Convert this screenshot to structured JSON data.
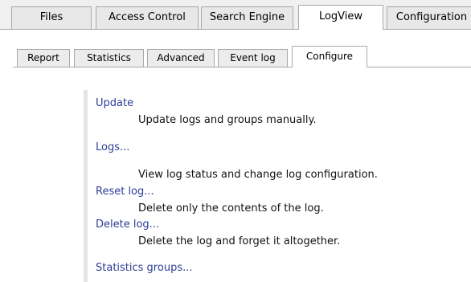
{
  "main_tabs": [
    {
      "label": "Files",
      "active": false
    },
    {
      "label": "Access Control",
      "active": false
    },
    {
      "label": "Search Engine",
      "active": false
    },
    {
      "label": "LogView",
      "active": true
    },
    {
      "label": "Configuration",
      "active": false
    }
  ],
  "sub_tabs": [
    {
      "label": "Report",
      "active": false
    },
    {
      "label": "Statistics",
      "active": false
    },
    {
      "label": "Advanced",
      "active": false
    },
    {
      "label": "Event log",
      "active": false
    },
    {
      "label": "Configure",
      "active": true
    }
  ],
  "entries": [
    {
      "link": "Update",
      "description": "Update logs and groups manually."
    },
    {
      "link": "Logs...",
      "description": "View log status and change log configuration."
    },
    {
      "link": "Reset log...",
      "description": "Delete only the contents of the log."
    },
    {
      "link": "Delete log...",
      "description": "Delete the log and forget it altogether."
    },
    {
      "link": "Statistics groups...",
      "description": ""
    }
  ],
  "colors": {
    "link": "#2d3e96",
    "tab_border": "#a8a8a8",
    "tab_inactive": "#e8e8e8",
    "tab_active": "#ffffff"
  }
}
